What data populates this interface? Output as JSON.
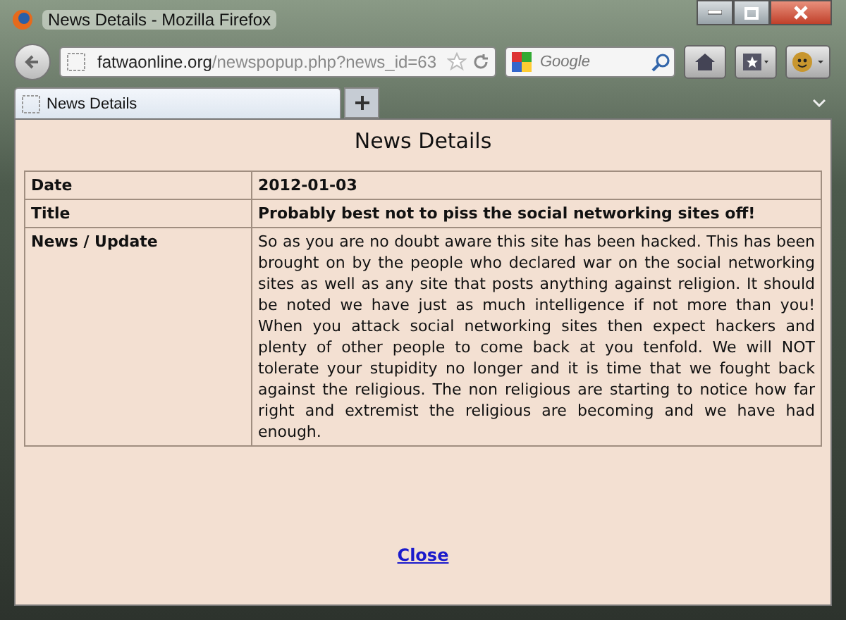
{
  "window": {
    "title": "News Details - Mozilla Firefox"
  },
  "toolbar": {
    "url_host": "fatwaonline.org",
    "url_path": "/newspopup.php?news_id=63",
    "search": {
      "placeholder": "Google"
    }
  },
  "tabs": [
    {
      "label": "News Details",
      "selected": true
    }
  ],
  "page": {
    "heading": "News Details",
    "rows": [
      {
        "label": "Date",
        "value": "2012-01-03",
        "kind": "bold"
      },
      {
        "label": "Title",
        "value": "Probably best not to piss the social networking sites off!",
        "kind": "bold"
      },
      {
        "label": "News / Update",
        "value": "So as you are no doubt aware this site has been hacked. This has been brought on by the people who declared war on the social networking sites as well as any site that posts anything against religion. It should be noted we have just as much intelligence if not more than you! When you attack social networking sites then expect hackers and plenty of other people to come back at you tenfold. We will NOT tolerate your stupidity no longer and it is time that we fought back against the religious. The non religious are starting to notice how far right and extremist the religious are becoming and we have had enough.",
        "kind": "text"
      }
    ],
    "close_link": "Close"
  }
}
